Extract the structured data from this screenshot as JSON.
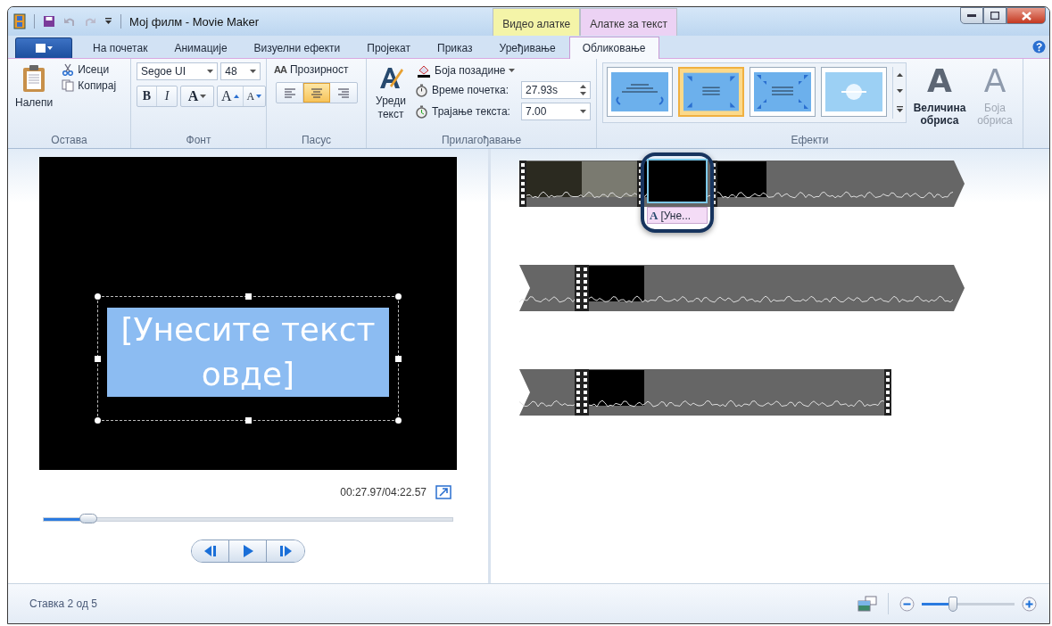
{
  "window": {
    "title": "Мој филм - Movie Maker"
  },
  "context_tabs": [
    {
      "label": "Видео алатке",
      "color": "#f4f4a8"
    },
    {
      "label": "Алатке за текст",
      "color": "#ecd2f4"
    }
  ],
  "tabs": [
    {
      "label": "На почетак",
      "selected": false
    },
    {
      "label": "Анимације",
      "selected": false
    },
    {
      "label": "Визуелни ефекти",
      "selected": false
    },
    {
      "label": "Пројекат",
      "selected": false
    },
    {
      "label": "Приказ",
      "selected": false
    },
    {
      "label": "Уређивање",
      "selected": false
    },
    {
      "label": "Обликовање",
      "selected": true
    }
  ],
  "clipboard": {
    "title": "Остава",
    "paste": "Налепи",
    "cut": "Исеци",
    "copy": "Копирај"
  },
  "font": {
    "title": "Фонт",
    "family": "Segoe UI",
    "size": "48",
    "bold": "B",
    "italic": "I",
    "color_glyph": "A",
    "grow_glyph": "A",
    "shrink_glyph": "A"
  },
  "paragraph": {
    "title": "Пасус",
    "transparency_glyph": "AA",
    "transparency": "Прозирност",
    "align": [
      {
        "kind": "left",
        "selected": false
      },
      {
        "kind": "center",
        "selected": true
      },
      {
        "kind": "right",
        "selected": false
      }
    ]
  },
  "adjust": {
    "title": "Прилагођавање",
    "edit_text": "Уреди текст",
    "background_color": "Боја позадине",
    "start_label": "Време почетка:",
    "start_value": "27.93s",
    "duration_label": "Трајање текста:",
    "duration_value": "7.00"
  },
  "effects": {
    "title": "Ефекти",
    "items": [
      {
        "kind": "arc",
        "selected": false
      },
      {
        "kind": "zoom",
        "selected": true
      },
      {
        "kind": "ripple",
        "selected": false
      },
      {
        "kind": "burst",
        "selected": false
      }
    ],
    "outline": [
      {
        "glyph": "A",
        "label": "Величина обриса",
        "disabled": false
      },
      {
        "glyph": "A",
        "label": "Боја обриса",
        "disabled": true
      }
    ]
  },
  "preview": {
    "caption": "[Унесите текст овде]",
    "time": "00:27.97/04:22.57",
    "seek": {
      "level": 0.11
    }
  },
  "timeline": {
    "caption_clip": {
      "glyph": "A",
      "label": "[Уне..."
    }
  },
  "status_bar": {
    "text": "Ставка 2 од 5",
    "zoom": {
      "level": 0.34
    }
  }
}
